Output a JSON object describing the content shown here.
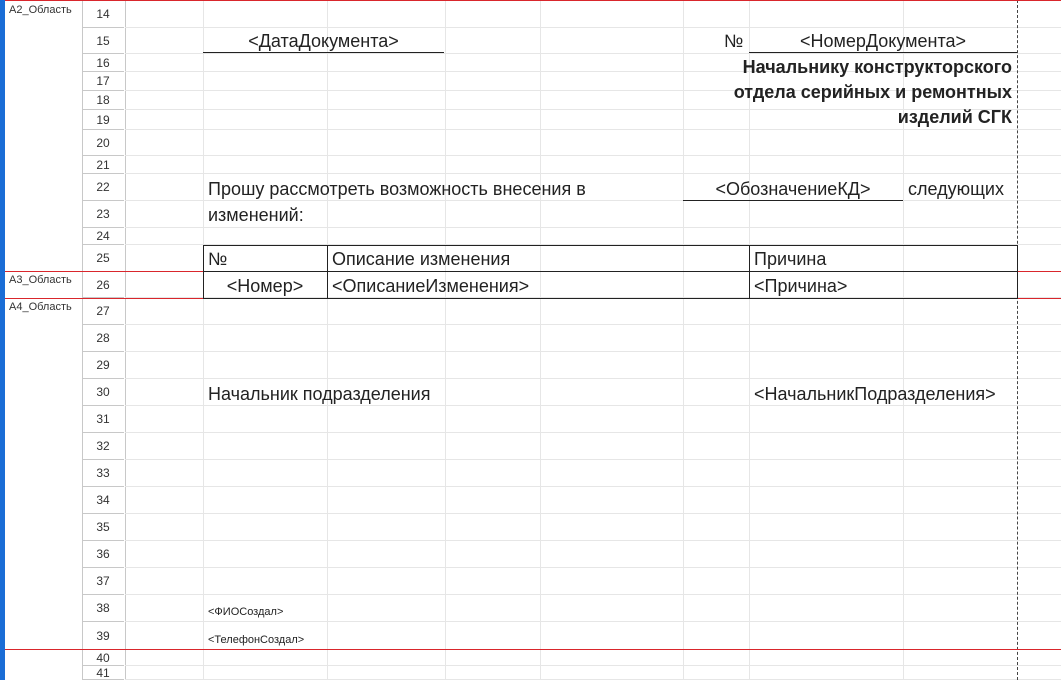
{
  "areas": [
    "A2_Область",
    "A3_Область",
    "A4_Область"
  ],
  "rows": [
    "14",
    "15",
    "16",
    "17",
    "18",
    "19",
    "20",
    "21",
    "22",
    "23",
    "24",
    "25",
    "26",
    "27",
    "28",
    "29",
    "30",
    "31",
    "32",
    "33",
    "34",
    "35",
    "36",
    "37",
    "38",
    "39",
    "40",
    "41"
  ],
  "header": {
    "date_placeholder": "<ДатаДокумента>",
    "number_sign": "№",
    "number_placeholder": "<НомерДокумента>",
    "addressee_line1": "Начальнику конструкторского",
    "addressee_line2": "отдела серийных и ремонтных",
    "addressee_line3": "изделий СГК"
  },
  "request": {
    "text_line1": "Прошу рассмотреть возможность внесения в",
    "kd_placeholder": "<ОбозначениеКД>",
    "text_following": "следующих",
    "text_line2": "изменений:"
  },
  "table": {
    "headers": [
      "№",
      "Описание изменения",
      "Причина"
    ],
    "row": [
      "<Номер>",
      "<ОписаниеИзменения>",
      "<Причина>"
    ]
  },
  "footer": {
    "head_label": "Начальник подразделения",
    "head_placeholder": "<НачальникПодразделения>",
    "creator_name": "<ФИОСоздал>",
    "creator_phone": "<ТелефонСоздал>"
  },
  "colors": {
    "area_separator": "#d9262c",
    "left_track": "#1a6dd6",
    "grid": "#e6e6e6"
  }
}
